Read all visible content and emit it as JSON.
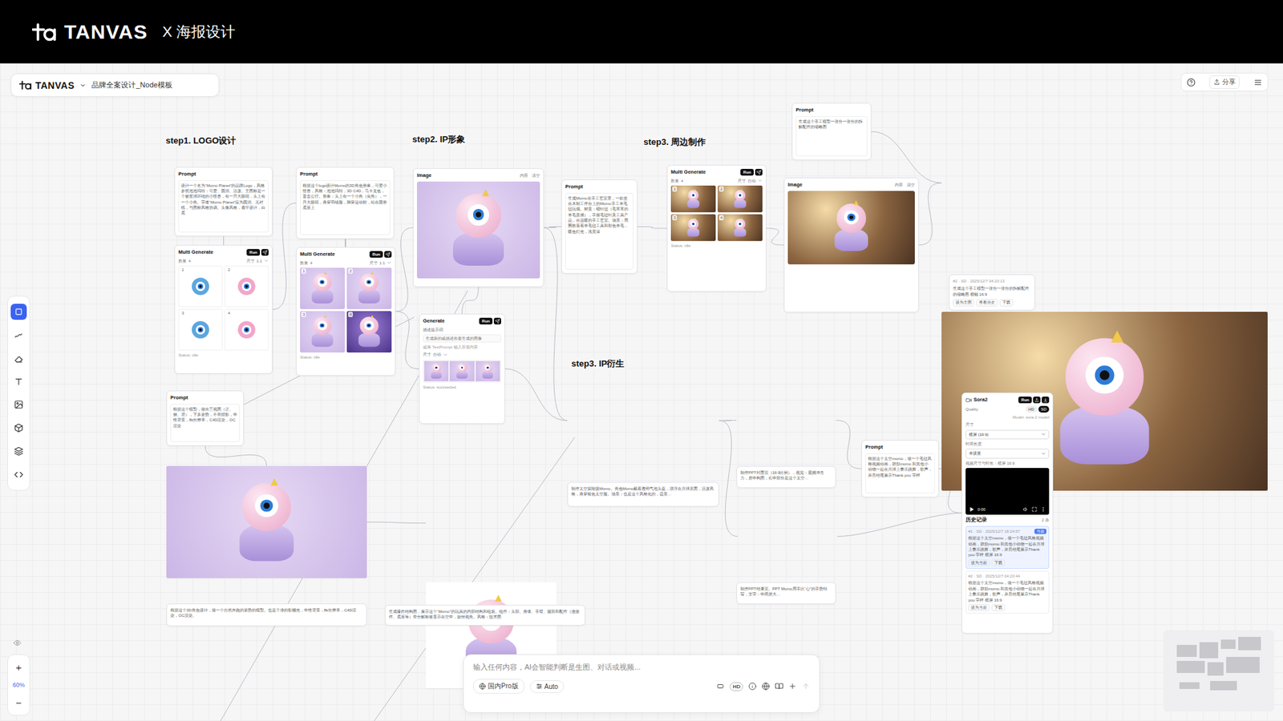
{
  "banner": {
    "logo": "TANVAS",
    "title": "X 海报设计"
  },
  "header": {
    "logo": "TANVAS",
    "project": "品牌全案设计_Node模板"
  },
  "topbar": {
    "share": "分享"
  },
  "toolbar": [
    {
      "selected": true
    },
    {
      "selected": false
    },
    {
      "selected": false
    },
    {
      "selected": false
    },
    {
      "selected": false
    },
    {
      "selected": false
    },
    {
      "selected": false
    },
    {
      "selected": false
    }
  ],
  "zoom": {
    "in": "+",
    "level": "60%",
    "out": "−"
  },
  "sections": [
    "step1. LOGO设计",
    "step2. IP形象",
    "step3. 周边制作",
    "step3. IP衍生"
  ],
  "nodes": [
    {
      "kind": "prompt",
      "title": "Prompt",
      "text": "设计一个名为“Momo Planet”的品牌Logo，风格参照泡泡玛特：可爱、圆润、活泼。主图标是一个被星球环绕的小怪兽，有一只大眼睛，头上有一个小角。字体“Momo Planet”应为圆润、无衬线，与图标风格协调。头像风格，扁平设计，白底"
    },
    {
      "kind": "multi",
      "title": "Multi Generate",
      "run": "Run",
      "count_label": "数量",
      "count": "4",
      "size_label": "尺寸",
      "size": "1:1",
      "tiles": [
        "1",
        "2",
        "3",
        "4"
      ],
      "status": "Status: idle"
    },
    {
      "kind": "prompt",
      "title": "Prompt",
      "text": "根据这个logo设计Momo的3D角色形象，可爱小怪兽，风格：泡泡玛特，3D C4D，马卡龙色，盲盒公仔。形象：头上有一个小角（尖角），一只大眼睛，身穿羽绒服，脚穿运动鞋，站在圆形底座上"
    },
    {
      "kind": "multi",
      "title": "Multi Generate",
      "run": "Run",
      "count_label": "数量",
      "count": "4",
      "size_label": "尺寸",
      "size": "1:1",
      "tiles": [
        "1",
        "2",
        "3",
        "4"
      ],
      "status": "Status: idle"
    },
    {
      "kind": "image",
      "title": "Image",
      "actions": [
        "内容",
        "清空"
      ]
    },
    {
      "kind": "generate",
      "title": "Generate",
      "run": "Run",
      "label": "描述提示词",
      "placeholder": "生成新的或描述你要生成的图像",
      "hint": "或将 TextPrompt 输入所需内容",
      "size_label": "尺寸",
      "size": "自动",
      "status": "Status: succeeded"
    },
    {
      "kind": "prompt",
      "title": "Prompt",
      "text": "根据这个模型，做出三视图（正、侧、背），下多姿势，不带阴影，中性背景，8k分辨率，C4D渲染，OC渲染"
    },
    {
      "kind": "photo"
    },
    {
      "kind": "text",
      "text": "根据这个3D角色设计，做一个自然奔跑的姿势的模型。也是干净的影棚光，中性背景，8k分辨率，C4D渲染，OC渲染。"
    },
    {
      "kind": "photo"
    },
    {
      "kind": "text",
      "text": "生成爆炸结构图，展示这个“Momo”的玩具的内部结构和组装。组件：头部、身体、手臂、腿部和配件（连接件、底座等）带分解标签显示在空中，旋转视角。风格：技术图"
    },
    {
      "kind": "prompt",
      "title": "Prompt",
      "text": "生成Momo在手工艺室里，一款坐在木制工作台上的Momo手工羊毛毡玩偶。材质：细针毡（毛茸茸的羊毛质感），手握毛毡针及工具产品，在温暖的手工艺室。场景：周围散落着羊毛毡工具和彩色羊毛，暖色灯光，浅景深"
    },
    {
      "kind": "multi",
      "title": "Multi Generate",
      "run": "Run",
      "count_label": "数量",
      "count": "4",
      "size_label": "尺寸",
      "size": "自动",
      "tiles": [
        "1",
        "2",
        "3",
        "4"
      ],
      "status": "Status: idle"
    },
    {
      "kind": "image",
      "title": "Image",
      "actions": [
        "内容",
        "清空"
      ]
    },
    {
      "kind": "prompt",
      "title": "Prompt",
      "text": "生成这个手工模型一张分一张分的拆解配件的缩略图"
    },
    {
      "kind": "photo"
    },
    {
      "kind": "caption",
      "meta": "#2 · SD · 2025/12/7 04:20:13",
      "text": "生成这个手工模型一张分一张分的拆解配件的缩略图 横幅 16:9",
      "buttons": [
        "设为主图",
        "查看历史",
        "下载"
      ]
    },
    {
      "kind": "photo"
    },
    {
      "kind": "text",
      "text": "制作太空探险版Momo。角色Momo戴着透明气泡头盔，漂浮在月球表面，活泼风格，身穿银色太空服。场景：也是这个风格化的，远景…"
    },
    {
      "kind": "photo"
    },
    {
      "kind": "text",
      "text": "制作PPT封面页（16:9比例），视觉：震撼冲击力，居中构图，右中部分是这个太空…"
    },
    {
      "kind": "photo"
    },
    {
      "kind": "text",
      "text": "制作PPT结束页。PPT Momo用手比“心”的手势特写，文字：中间居大…"
    },
    {
      "kind": "prompt",
      "title": "Prompt",
      "text": "根据这个太空momo，做一个毛毡风格视频动画，鼓励momo 和其他小动物一起在月球上奏乐跳舞，歌声，并且结尾展示Thank you 字样"
    },
    {
      "kind": "sora",
      "title": "Sora2",
      "run": "Run",
      "quality_label": "Quality",
      "qualities": [
        {
          "label": "HD",
          "selected": false
        },
        {
          "label": "SD",
          "selected": true
        }
      ],
      "model": "Model: sora-2 model",
      "size_label": "尺寸",
      "size": "横屏 (16:9)",
      "duration_label": "时间长度",
      "duration": "未设置",
      "hint": "视频尺寸与时长：横屏 16:9",
      "time": "0:00",
      "history_title": "历史记录",
      "history_count": "2 条",
      "history": [
        {
          "meta": "#1 · SD · 2025/12/7 18:24:57",
          "badge": "当前",
          "text": "根据这个太空momo，做一个毛毡风格视频动画，鼓励momo 和其他小动物一起在月球上奏乐跳舞，歌声，并且结尾展示Thank you 字样 横屏 16:9",
          "buttons": [
            "设为当前",
            "下载"
          ],
          "selected": true
        },
        {
          "meta": "#2 · SD · 2025/12/7 04:20:44",
          "text": "根据这个太空momo，做一个毛毡风格视频动画，鼓励momo 和其他小动物一起在月球上奏乐跳舞，歌声，并且结尾展示Thank you 字样 横屏 16:9",
          "buttons": [
            "设为当前",
            "下载"
          ],
          "selected": false
        }
      ]
    }
  ],
  "input": {
    "placeholder": "输入任何内容，AI会智能判断是生图、对话或视频...",
    "model": "国内Pro版",
    "mode": "Auto",
    "hd": "HD"
  }
}
